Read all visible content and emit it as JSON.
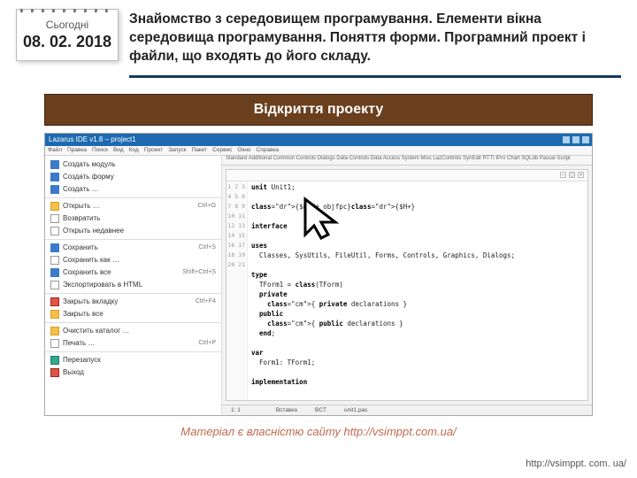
{
  "date_card": {
    "today": "Сьогодні",
    "date": "08. 02. 2018"
  },
  "title": "Знайомство з середовищем програмування. Елементи вікна середовища програмування. Поняття форми. Програмний проект і файли, що входять до його складу.",
  "banner": "Відкриття проекту",
  "ide": {
    "title": "Lazarus IDE v1.8 – project1",
    "menubar": [
      "Файл",
      "Правка",
      "Поиск",
      "Вид",
      "Код",
      "Проект",
      "Запуск",
      "Пакет",
      "Сервис",
      "Окно",
      "Справка"
    ],
    "tab_strip": "Standard  Additional  Common Controls  Dialogs  Data Controls  Data Access  System  Misc  LazControls  SynEdit  RTTI  IPro  Chart  SQLdb  Pascal Script",
    "menu_items": [
      {
        "label": "Создать модуль",
        "ic": "blue"
      },
      {
        "label": "Создать форму",
        "ic": "blue"
      },
      {
        "label": "Создать …",
        "ic": "blue"
      },
      {
        "sep": true
      },
      {
        "label": "Открыть …",
        "ic": "yellow",
        "sc": "Ctrl+O"
      },
      {
        "label": "Возвратить",
        "ic": ""
      },
      {
        "label": "Открыть недавнее",
        "ic": ""
      },
      {
        "sep": true
      },
      {
        "label": "Сохранить",
        "ic": "blue",
        "sc": "Ctrl+S"
      },
      {
        "label": "Сохранить как …",
        "ic": ""
      },
      {
        "label": "Сохранить все",
        "ic": "blue",
        "sc": "Shift+Ctrl+S"
      },
      {
        "label": "Экспортировать в HTML",
        "ic": ""
      },
      {
        "sep": true
      },
      {
        "label": "Закрыть вкладку",
        "ic": "red",
        "sc": "Ctrl+F4"
      },
      {
        "label": "Закрыть все",
        "ic": "yellow"
      },
      {
        "sep": true
      },
      {
        "label": "Очистить каталог …",
        "ic": "yellow"
      },
      {
        "label": "Печать …",
        "ic": "",
        "sc": "Ctrl+P"
      },
      {
        "sep": true
      },
      {
        "label": "Перезапуск",
        "ic": "green"
      },
      {
        "label": "Выход",
        "ic": "red"
      }
    ],
    "code": {
      "line_start": 1,
      "line_end": 21,
      "lines": [
        "unit Unit1;",
        "",
        "{$mode objfpc}{$H+}",
        "",
        "interface",
        "",
        "uses",
        "  Classes, SysUtils, FileUtil, Forms, Controls, Graphics, Dialogs;",
        "",
        "type",
        "  TForm1 = class(TForm)",
        "  private",
        "    { private declarations }",
        "  public",
        "    { public declarations }",
        "  end;",
        "",
        "var",
        "  Form1: TForm1;",
        "",
        "implementation"
      ],
      "status": [
        "1: 1",
        "",
        "Вставка",
        "BCT",
        "unit1.pas"
      ]
    }
  },
  "footer_center": "Матеріал є власністю сайту http://vsimppt.com.ua/",
  "footer_right": "http://vsimppt. com. ua/"
}
